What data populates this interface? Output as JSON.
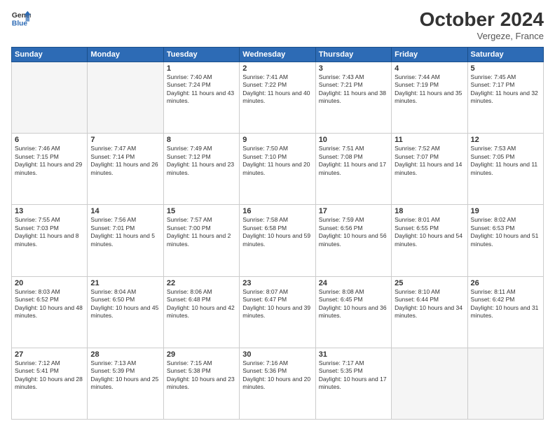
{
  "header": {
    "logo_line1": "General",
    "logo_line2": "Blue",
    "month": "October 2024",
    "location": "Vergeze, France"
  },
  "days_of_week": [
    "Sunday",
    "Monday",
    "Tuesday",
    "Wednesday",
    "Thursday",
    "Friday",
    "Saturday"
  ],
  "weeks": [
    [
      {
        "day": "",
        "info": ""
      },
      {
        "day": "",
        "info": ""
      },
      {
        "day": "1",
        "info": "Sunrise: 7:40 AM\nSunset: 7:24 PM\nDaylight: 11 hours and 43 minutes."
      },
      {
        "day": "2",
        "info": "Sunrise: 7:41 AM\nSunset: 7:22 PM\nDaylight: 11 hours and 40 minutes."
      },
      {
        "day": "3",
        "info": "Sunrise: 7:43 AM\nSunset: 7:21 PM\nDaylight: 11 hours and 38 minutes."
      },
      {
        "day": "4",
        "info": "Sunrise: 7:44 AM\nSunset: 7:19 PM\nDaylight: 11 hours and 35 minutes."
      },
      {
        "day": "5",
        "info": "Sunrise: 7:45 AM\nSunset: 7:17 PM\nDaylight: 11 hours and 32 minutes."
      }
    ],
    [
      {
        "day": "6",
        "info": "Sunrise: 7:46 AM\nSunset: 7:15 PM\nDaylight: 11 hours and 29 minutes."
      },
      {
        "day": "7",
        "info": "Sunrise: 7:47 AM\nSunset: 7:14 PM\nDaylight: 11 hours and 26 minutes."
      },
      {
        "day": "8",
        "info": "Sunrise: 7:49 AM\nSunset: 7:12 PM\nDaylight: 11 hours and 23 minutes."
      },
      {
        "day": "9",
        "info": "Sunrise: 7:50 AM\nSunset: 7:10 PM\nDaylight: 11 hours and 20 minutes."
      },
      {
        "day": "10",
        "info": "Sunrise: 7:51 AM\nSunset: 7:08 PM\nDaylight: 11 hours and 17 minutes."
      },
      {
        "day": "11",
        "info": "Sunrise: 7:52 AM\nSunset: 7:07 PM\nDaylight: 11 hours and 14 minutes."
      },
      {
        "day": "12",
        "info": "Sunrise: 7:53 AM\nSunset: 7:05 PM\nDaylight: 11 hours and 11 minutes."
      }
    ],
    [
      {
        "day": "13",
        "info": "Sunrise: 7:55 AM\nSunset: 7:03 PM\nDaylight: 11 hours and 8 minutes."
      },
      {
        "day": "14",
        "info": "Sunrise: 7:56 AM\nSunset: 7:01 PM\nDaylight: 11 hours and 5 minutes."
      },
      {
        "day": "15",
        "info": "Sunrise: 7:57 AM\nSunset: 7:00 PM\nDaylight: 11 hours and 2 minutes."
      },
      {
        "day": "16",
        "info": "Sunrise: 7:58 AM\nSunset: 6:58 PM\nDaylight: 10 hours and 59 minutes."
      },
      {
        "day": "17",
        "info": "Sunrise: 7:59 AM\nSunset: 6:56 PM\nDaylight: 10 hours and 56 minutes."
      },
      {
        "day": "18",
        "info": "Sunrise: 8:01 AM\nSunset: 6:55 PM\nDaylight: 10 hours and 54 minutes."
      },
      {
        "day": "19",
        "info": "Sunrise: 8:02 AM\nSunset: 6:53 PM\nDaylight: 10 hours and 51 minutes."
      }
    ],
    [
      {
        "day": "20",
        "info": "Sunrise: 8:03 AM\nSunset: 6:52 PM\nDaylight: 10 hours and 48 minutes."
      },
      {
        "day": "21",
        "info": "Sunrise: 8:04 AM\nSunset: 6:50 PM\nDaylight: 10 hours and 45 minutes."
      },
      {
        "day": "22",
        "info": "Sunrise: 8:06 AM\nSunset: 6:48 PM\nDaylight: 10 hours and 42 minutes."
      },
      {
        "day": "23",
        "info": "Sunrise: 8:07 AM\nSunset: 6:47 PM\nDaylight: 10 hours and 39 minutes."
      },
      {
        "day": "24",
        "info": "Sunrise: 8:08 AM\nSunset: 6:45 PM\nDaylight: 10 hours and 36 minutes."
      },
      {
        "day": "25",
        "info": "Sunrise: 8:10 AM\nSunset: 6:44 PM\nDaylight: 10 hours and 34 minutes."
      },
      {
        "day": "26",
        "info": "Sunrise: 8:11 AM\nSunset: 6:42 PM\nDaylight: 10 hours and 31 minutes."
      }
    ],
    [
      {
        "day": "27",
        "info": "Sunrise: 7:12 AM\nSunset: 5:41 PM\nDaylight: 10 hours and 28 minutes."
      },
      {
        "day": "28",
        "info": "Sunrise: 7:13 AM\nSunset: 5:39 PM\nDaylight: 10 hours and 25 minutes."
      },
      {
        "day": "29",
        "info": "Sunrise: 7:15 AM\nSunset: 5:38 PM\nDaylight: 10 hours and 23 minutes."
      },
      {
        "day": "30",
        "info": "Sunrise: 7:16 AM\nSunset: 5:36 PM\nDaylight: 10 hours and 20 minutes."
      },
      {
        "day": "31",
        "info": "Sunrise: 7:17 AM\nSunset: 5:35 PM\nDaylight: 10 hours and 17 minutes."
      },
      {
        "day": "",
        "info": ""
      },
      {
        "day": "",
        "info": ""
      }
    ]
  ]
}
